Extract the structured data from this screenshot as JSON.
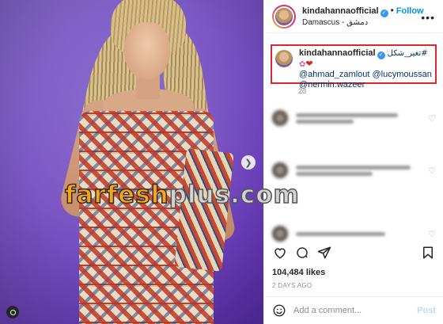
{
  "post": {
    "image_alt": "Woman in patterned dress with long braids against purple background"
  },
  "header": {
    "username": "kindahannaofficial",
    "follow_label": "Follow",
    "location": "Damascus - دمشق",
    "more_icon": "more-horizontal-icon"
  },
  "caption": {
    "username": "kindahannaofficial",
    "text_arabic": "تغير_شكل#",
    "mentions": [
      "@ahmad_zamlout",
      "@lucymoussan",
      "@nermin.wazeer"
    ],
    "age": "2d"
  },
  "watermark": {
    "part1": "farfesh",
    "part2": "plus.com"
  },
  "stats": {
    "likes": "104,484 likes",
    "date": "2 DAYS AGO"
  },
  "composer": {
    "placeholder": "Add a comment...",
    "post_label": "Post"
  },
  "colors": {
    "link_blue": "#0095f6",
    "highlight_red": "#e0252e",
    "mention": "#00376b"
  }
}
